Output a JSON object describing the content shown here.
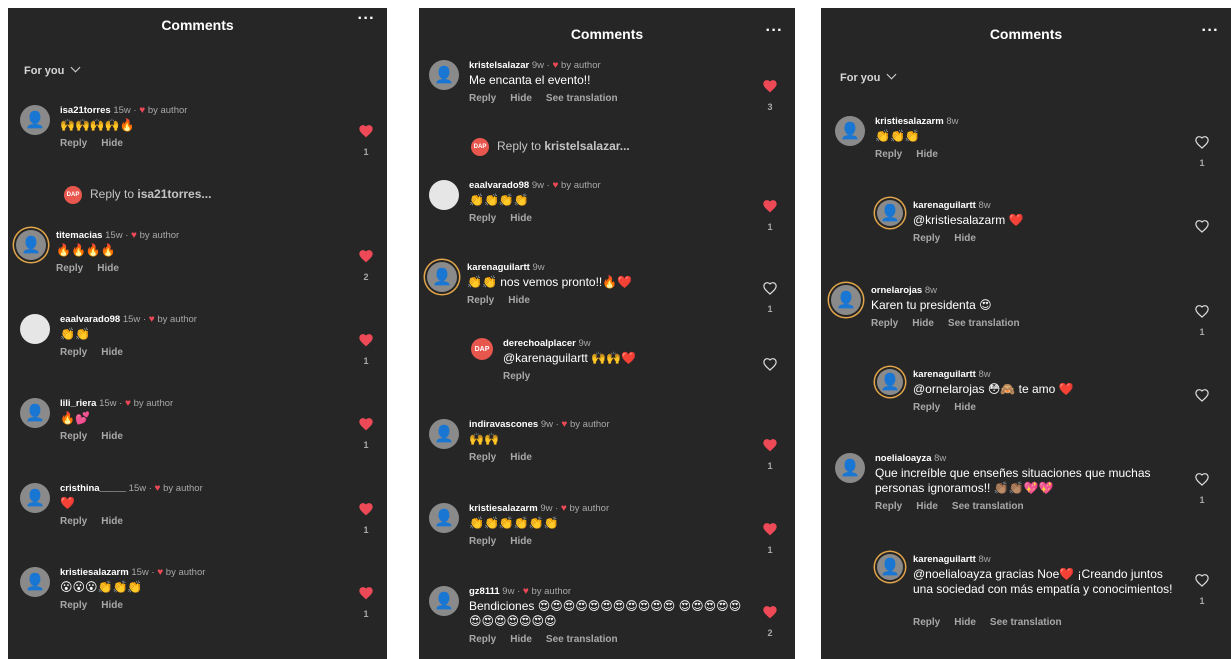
{
  "panels": [
    {
      "title": "Comments",
      "more": "···",
      "filter": "For you",
      "comments": [
        {
          "user": "isa21torres",
          "time": "15w",
          "liked_by": "by author",
          "text": "🙌🙌🙌🙌🔥",
          "actions": [
            "Reply",
            "Hide"
          ],
          "likes": "1",
          "liked": true
        },
        {
          "user": "titemacias",
          "time": "15w",
          "liked_by": "by author",
          "text": "🔥🔥🔥🔥",
          "actions": [
            "Reply",
            "Hide"
          ],
          "likes": "2",
          "liked": true
        },
        {
          "user": "eaalvarado98",
          "time": "15w",
          "liked_by": "by author",
          "text": "👏👏",
          "actions": [
            "Reply",
            "Hide"
          ],
          "likes": "1",
          "liked": true
        },
        {
          "user": "lili_riera",
          "time": "15w",
          "liked_by": "by author",
          "text": "🔥💕",
          "actions": [
            "Reply",
            "Hide"
          ],
          "likes": "1",
          "liked": true
        },
        {
          "user": "cristhina_____",
          "time": "15w",
          "liked_by": "by author",
          "text": "❤️",
          "actions": [
            "Reply",
            "Hide"
          ],
          "likes": "1",
          "liked": true
        },
        {
          "user": "kristiesalazarm",
          "time": "15w",
          "liked_by": "by author",
          "text": "😮😮😮👏👏👏",
          "actions": [
            "Reply",
            "Hide"
          ],
          "likes": "1",
          "liked": true
        }
      ],
      "reply_to": {
        "prefix": "Reply to ",
        "user": "isa21torres..."
      }
    },
    {
      "title": "Comments",
      "more": "···",
      "comments": [
        {
          "user": "kristelsalazar",
          "time": "9w",
          "liked_by": "by author",
          "text": "Me encanta el evento!!",
          "actions": [
            "Reply",
            "Hide",
            "See translation"
          ],
          "likes": "3",
          "liked": true
        },
        {
          "user": "eaalvarado98",
          "time": "9w",
          "liked_by": "by author",
          "text": "👏👏👏👏",
          "actions": [
            "Reply",
            "Hide"
          ],
          "likes": "1",
          "liked": true
        },
        {
          "user": "karenaguilartt",
          "time": "9w",
          "liked_by": "",
          "text": "👏👏 nos vemos pronto!!🔥❤️",
          "actions": [
            "Reply",
            "Hide"
          ],
          "likes": "1",
          "liked": false
        },
        {
          "user": "derechoalplacer",
          "time": "9w",
          "liked_by": "",
          "text": "@karenaguilartt 🙌🙌❤️",
          "actions": [
            "Reply"
          ],
          "likes": "",
          "liked": false
        },
        {
          "user": "indiravascones",
          "time": "9w",
          "liked_by": "by author",
          "text": "🙌🙌",
          "actions": [
            "Reply",
            "Hide"
          ],
          "likes": "1",
          "liked": true
        },
        {
          "user": "kristiesalazarm",
          "time": "9w",
          "liked_by": "by author",
          "text": "👏👏👏👏👏👏",
          "actions": [
            "Reply",
            "Hide"
          ],
          "likes": "1",
          "liked": true
        },
        {
          "user": "gz8111",
          "time": "9w",
          "liked_by": "by author",
          "text": "Bendiciones 😍😍😍😍😍😍😍😍😍😍😍 😍😍😍😍😍😍😍😍😍😍😍😍",
          "actions": [
            "Reply",
            "Hide",
            "See translation"
          ],
          "likes": "2",
          "liked": true
        }
      ],
      "reply_to": {
        "prefix": "Reply to ",
        "user": "kristelsalazar..."
      }
    },
    {
      "title": "Comments",
      "more": "···",
      "filter": "For you",
      "comments": [
        {
          "user": "kristiesalazarm",
          "time": "8w",
          "liked_by": "",
          "text": "👏👏👏",
          "actions": [
            "Reply",
            "Hide"
          ],
          "likes": "1",
          "liked": false
        },
        {
          "user": "karenaguilartt",
          "time": "8w",
          "liked_by": "",
          "text": "@kristiesalazarm ❤️",
          "actions": [
            "Reply",
            "Hide"
          ],
          "likes": "",
          "liked": false
        },
        {
          "user": "ornelarojas",
          "time": "8w",
          "liked_by": "",
          "text": "Karen tu presidenta 😍",
          "actions": [
            "Reply",
            "Hide",
            "See translation"
          ],
          "likes": "1",
          "liked": false
        },
        {
          "user": "karenaguilartt",
          "time": "8w",
          "liked_by": "",
          "text": "@ornelarojas 😳🙈 te amo ❤️",
          "actions": [
            "Reply",
            "Hide"
          ],
          "likes": "",
          "liked": false
        },
        {
          "user": "noelialoayza",
          "time": "8w",
          "liked_by": "",
          "text": "Que increíble que enseñes situaciones que muchas personas ignoramos!! 👏🏽👏🏽💖💖",
          "actions": [
            "Reply",
            "Hide",
            "See translation"
          ],
          "likes": "1",
          "liked": false
        },
        {
          "user": "karenaguilartt",
          "time": "8w",
          "liked_by": "",
          "text": "@noelialoayza gracias Noe❤️ ¡Creando juntos una sociedad con más empatía y conocimientos!",
          "actions": [
            "Reply",
            "Hide",
            "See translation"
          ],
          "likes": "1",
          "liked": false
        }
      ]
    }
  ],
  "icons": {
    "liked": "heart-filled-icon",
    "unliked": "heart-outline-icon",
    "more": "more-icon",
    "chevron": "chevron-down-icon"
  },
  "colors": {
    "background": "#262626",
    "like": "#ed4956",
    "muted": "#a8a8a8",
    "text": "#ffffff"
  }
}
